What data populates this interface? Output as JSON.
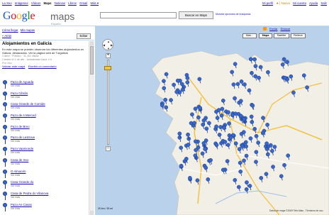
{
  "topbar": {
    "nav": [
      "La Xeo",
      "Imágenes",
      "Vídeos",
      "Maps",
      "Noticias",
      "Libros",
      "Gmail",
      "Más ▾"
    ],
    "selected_nav": "Maps",
    "user_links": [
      "Mi perfil",
      "★ | Nuevo",
      "Mi cuenta",
      "Ayuda",
      "Salir"
    ]
  },
  "logo": {
    "google": "Google",
    "maps": "maps",
    "region": "España"
  },
  "search": {
    "value": "",
    "button": "Buscar en Maps",
    "options": "Mostrar opciones de búsqueda"
  },
  "left_header": {
    "links": [
      "Cómo llegar",
      "Mis mapas"
    ],
    "back": "« Atrás",
    "edit_button": "Editar"
  },
  "map_info": {
    "title": "Alojamientos en Galicia",
    "description": "En este mapa se pueden observar los diferentes alojamientos en Galicia, destacados. Ver la página web de Turgalicia",
    "meta_lines": [
      "1 abre · Público · 11.111 vistas",
      "Creado el 1 de abr · Actualizado hace 4 h",
      "Por Xeo"
    ],
    "links": [
      "Valorar este mapa",
      "Escribir un comentario"
    ]
  },
  "results": [
    {
      "name": "Pazo de Aguada",
      "sub": "Ver más"
    },
    {
      "name": "Pazo Cibrán",
      "sub": "Ver más"
    },
    {
      "name": "Casa Grande de Cornide",
      "sub": "Ver más"
    },
    {
      "name": "Pazo de A Merced",
      "sub": "Ver más"
    },
    {
      "name": "Pazo de Breo",
      "sub": "Ver más"
    },
    {
      "name": "Pazo de Lestrove",
      "sub": "Ver más"
    },
    {
      "name": "Pazo Vaamonde",
      "sub": "Ver más"
    },
    {
      "name": "Casa de Xeo",
      "sub": "Ver más"
    },
    {
      "name": "O Almacén",
      "sub": "Ver más"
    },
    {
      "name": "Casa Grande do",
      "sub": "Ver más"
    },
    {
      "name": "Casa de Pedra do Vilanova",
      "sub": "Ver más"
    },
    {
      "name": "Pazo As Casas",
      "sub": "Ver más"
    }
  ],
  "map": {
    "links": [
      "Enviar",
      "Enlazar"
    ],
    "buttons": [
      "Más...",
      "Mapa",
      "Satélite",
      "Relieve"
    ],
    "nav_labels": [
      "▲",
      "◀",
      "▶",
      "▼"
    ],
    "zoom_plus": "+",
    "zoom_minus": "−",
    "scale": "20 km / 20 mi",
    "copyright": "Datos de mapa ©2009 Tele Atlas - Términos de uso"
  },
  "colors": {
    "link": "#1a0dab",
    "marker": "#3a66c8",
    "land": "#f2efe6",
    "sea": "#b9d1ea"
  }
}
